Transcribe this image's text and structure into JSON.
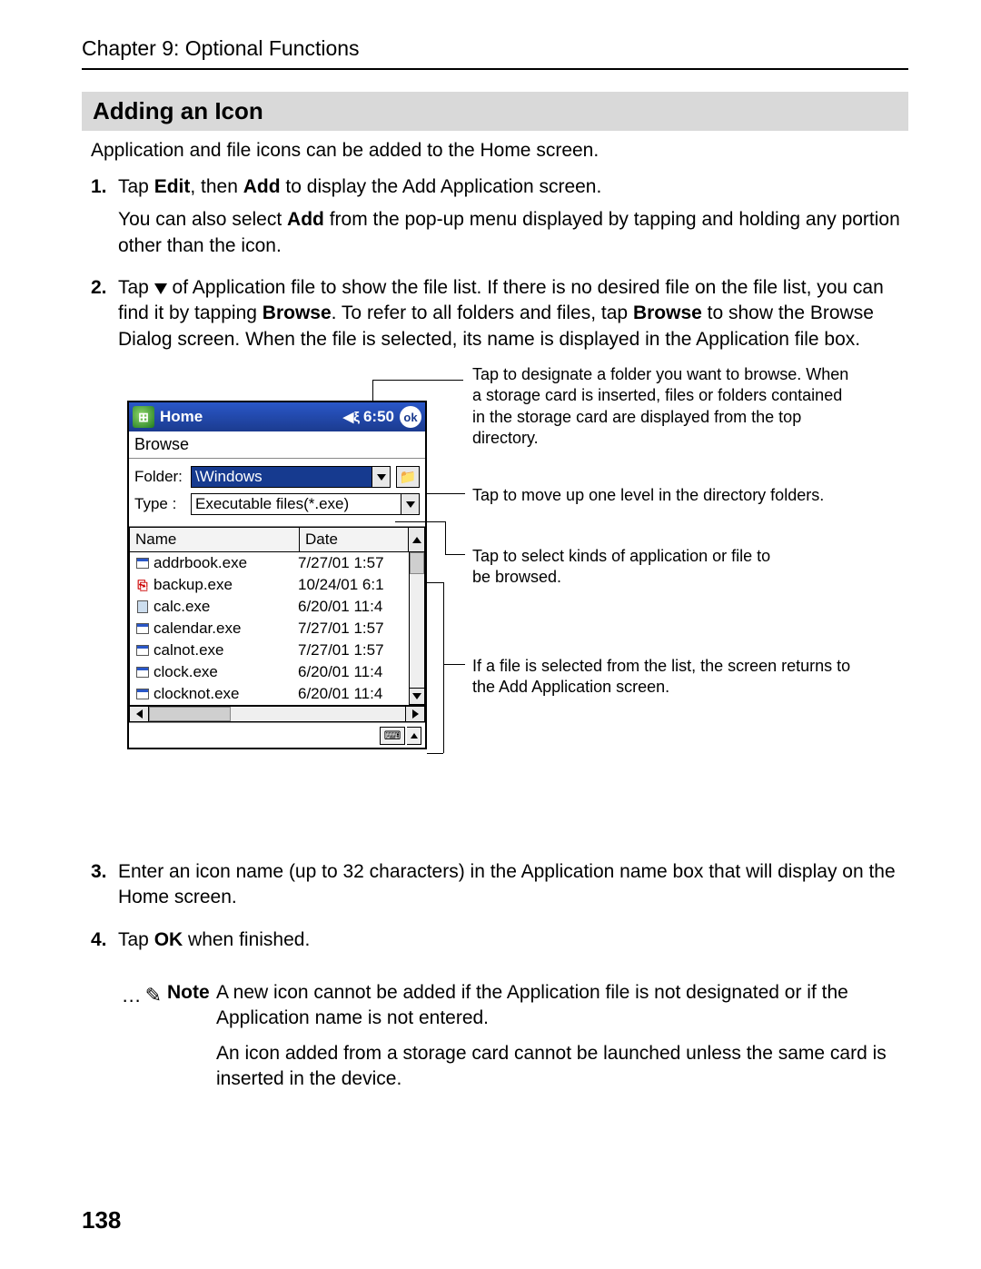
{
  "chapter": "Chapter 9: Optional Functions",
  "section_title": "Adding an Icon",
  "intro": "Application and file icons can be added to the Home screen.",
  "steps": {
    "s1": {
      "num": "1.",
      "a": "Tap ",
      "b": "Edit",
      "c": ", then ",
      "d": "Add",
      "e": " to display the Add Application screen.",
      "p2a": "You can also select ",
      "p2b": "Add",
      "p2c": " from the pop-up menu displayed by tapping and holding any portion other than the icon."
    },
    "s2": {
      "num": "2.",
      "a": "Tap ",
      "b": " of Application file to show the file list. If there is no desired file on the file list, you can find it by tapping ",
      "c": "Browse",
      "d": ". To refer to all folders and files, tap ",
      "e": "Browse",
      "f": " to show the Browse Dialog screen. When the file is selected, its name is displayed in the Application file box."
    },
    "s3": {
      "num": "3.",
      "text": "Enter an icon name (up to 32 characters) in the Application name box that will display on the Home screen."
    },
    "s4": {
      "num": "4.",
      "a": "Tap ",
      "b": "OK",
      "c": " when finished."
    }
  },
  "device": {
    "title": "Home",
    "time": "6:50",
    "ok": "ok",
    "browse": "Browse",
    "folder_label": "Folder:",
    "folder_value": "\\Windows",
    "type_label": "Type :",
    "type_value": "Executable files(*.exe)",
    "col_name": "Name",
    "col_date": "Date",
    "rows": [
      {
        "name": "addrbook.exe",
        "date": "7/27/01 1:57",
        "icon": "win"
      },
      {
        "name": "backup.exe",
        "date": "10/24/01 6:1",
        "icon": "backup"
      },
      {
        "name": "calc.exe",
        "date": "6/20/01 11:4",
        "icon": "calc"
      },
      {
        "name": "calendar.exe",
        "date": "7/27/01 1:57",
        "icon": "win"
      },
      {
        "name": "calnot.exe",
        "date": "7/27/01 1:57",
        "icon": "win"
      },
      {
        "name": "clock.exe",
        "date": "6/20/01 11:4",
        "icon": "win"
      },
      {
        "name": "clocknot.exe",
        "date": "6/20/01 11:4",
        "icon": "win"
      }
    ]
  },
  "callouts": {
    "c1": "Tap to designate a folder you want to browse. When a storage card is inserted, files or folders contained in the storage card are displayed from the top directory.",
    "c2": "Tap to move up one level in the directory folders.",
    "c3": "Tap to select kinds of application or file to be browsed.",
    "c4": "If a file is selected from the list, the screen returns to the Add Application screen."
  },
  "note": {
    "label": "Note",
    "p1": "A new icon cannot be added if the Application file is not designated or if the Application name is not entered.",
    "p2": "An icon added from a storage card cannot be launched unless the same card is inserted in the device."
  },
  "page_number": "138"
}
